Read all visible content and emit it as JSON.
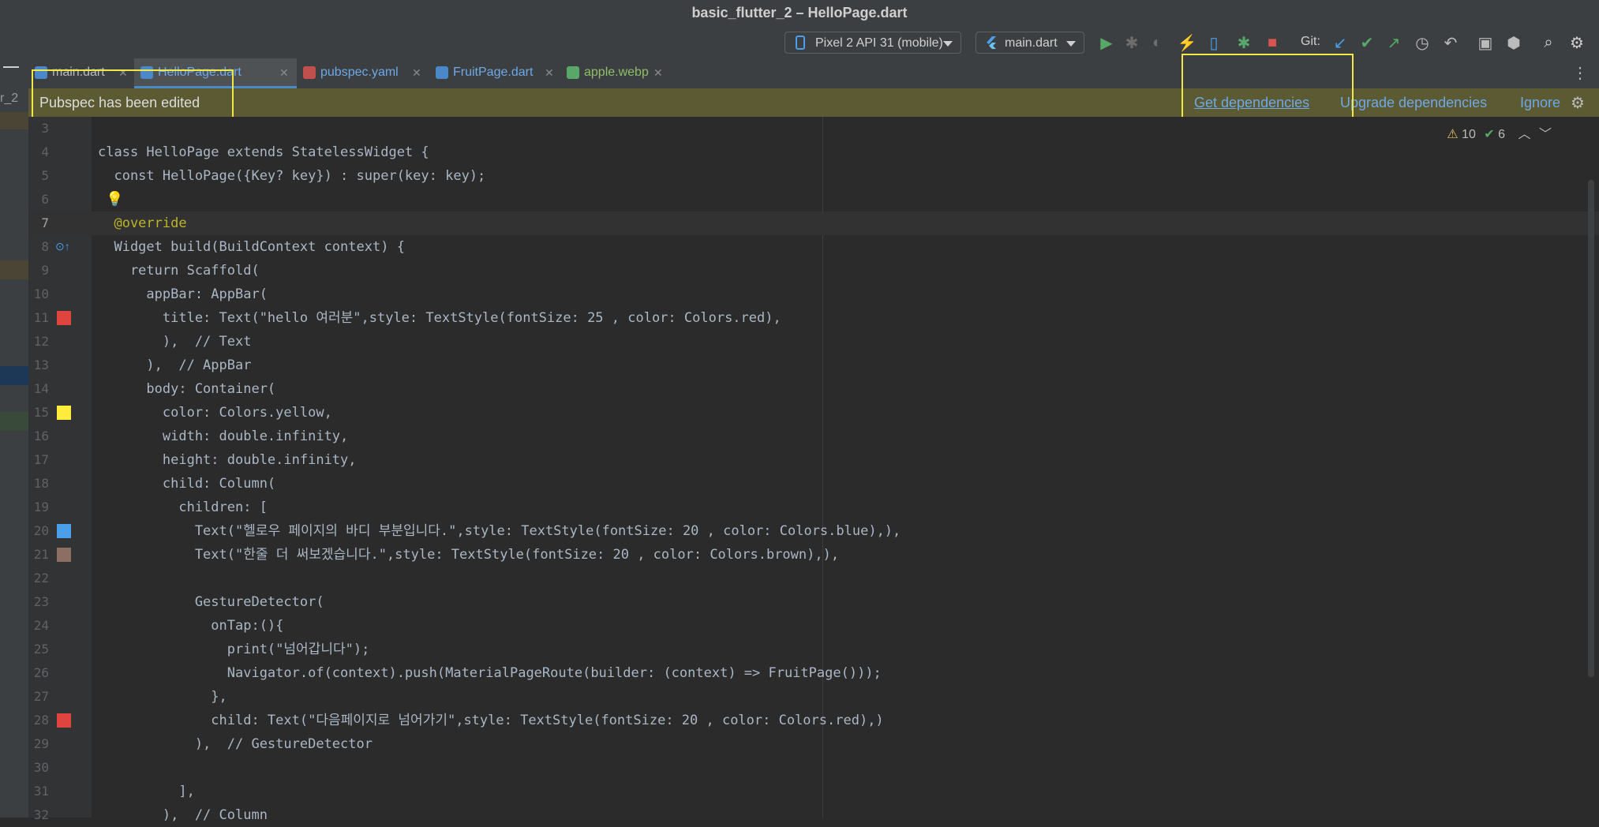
{
  "window": {
    "title": "basic_flutter_2 – HelloPage.dart"
  },
  "toolbar": {
    "device": "Pixel 2 API 31 (mobile)",
    "run_config": "main.dart",
    "git_label": "Git:"
  },
  "left_strip": {
    "project_label": "r_2"
  },
  "tabs": [
    {
      "label": "main.dart",
      "color": "#6fa8e6"
    },
    {
      "label": "HelloPage.dart",
      "color": "#6fa8e6"
    },
    {
      "label": "pubspec.yaml",
      "color": "#6fa8e6"
    },
    {
      "label": "FruitPage.dart",
      "color": "#6fa8e6"
    },
    {
      "label": "apple.webp",
      "color": "#8fbf6a"
    }
  ],
  "banner": {
    "message": "Pubspec has been edited",
    "get_deps": "Get dependencies",
    "upgrade_deps": "Upgrade dependencies",
    "ignore": "Ignore"
  },
  "inspections": {
    "warnings": "10",
    "weak_warnings": "6"
  },
  "colors": {
    "red": "#e0443e",
    "yellow": "#ffeb3b",
    "blue": "#4a9eea",
    "brown": "#8d6e63",
    "accent": "#4a88c7"
  },
  "lines": [
    {
      "n": "3",
      "code": ""
    },
    {
      "n": "4",
      "code": "class HelloPage extends StatelessWidget {"
    },
    {
      "n": "5",
      "code": "  const HelloPage({Key? key}) : super(key: key);"
    },
    {
      "n": "6",
      "code": ""
    },
    {
      "n": "7",
      "code": "  @override"
    },
    {
      "n": "8",
      "code": "  Widget build(BuildContext context) {"
    },
    {
      "n": "9",
      "code": "    return Scaffold("
    },
    {
      "n": "10",
      "code": "      appBar: AppBar("
    },
    {
      "n": "11",
      "code": "        title: Text(\"hello 여러분\",style: TextStyle(fontSize: 25 , color: Colors.red),"
    },
    {
      "n": "12",
      "code": "        ),  // Text"
    },
    {
      "n": "13",
      "code": "      ),  // AppBar"
    },
    {
      "n": "14",
      "code": "      body: Container("
    },
    {
      "n": "15",
      "code": "        color: Colors.yellow,"
    },
    {
      "n": "16",
      "code": "        width: double.infinity,"
    },
    {
      "n": "17",
      "code": "        height: double.infinity,"
    },
    {
      "n": "18",
      "code": "        child: Column("
    },
    {
      "n": "19",
      "code": "          children: ["
    },
    {
      "n": "20",
      "code": "            Text(\"헬로우 페이지의 바디 부분입니다.\",style: TextStyle(fontSize: 20 , color: Colors.blue),),"
    },
    {
      "n": "21",
      "code": "            Text(\"한줄 더 써보겠습니다.\",style: TextStyle(fontSize: 20 , color: Colors.brown),),"
    },
    {
      "n": "22",
      "code": ""
    },
    {
      "n": "23",
      "code": "            GestureDetector("
    },
    {
      "n": "24",
      "code": "              onTap:(){"
    },
    {
      "n": "25",
      "code": "                print(\"넘어갑니다\");"
    },
    {
      "n": "26",
      "code": "                Navigator.of(context).push(MaterialPageRoute(builder: (context) => FruitPage()));"
    },
    {
      "n": "27",
      "code": "              },"
    },
    {
      "n": "28",
      "code": "              child: Text(\"다음페이지로 넘어가기\",style: TextStyle(fontSize: 20 , color: Colors.red),)"
    },
    {
      "n": "29",
      "code": "            ),  // GestureDetector"
    },
    {
      "n": "30",
      "code": ""
    },
    {
      "n": "31",
      "code": "          ],"
    },
    {
      "n": "32",
      "code": "        ),  // Column"
    }
  ]
}
